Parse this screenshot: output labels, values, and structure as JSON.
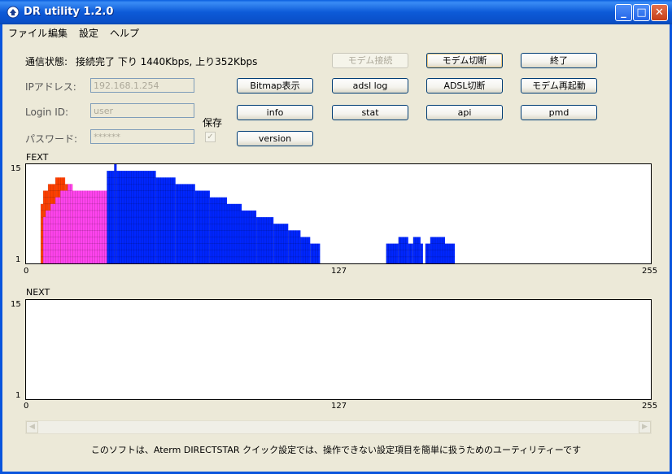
{
  "window": {
    "title": "DR utility 1.2.0"
  },
  "titlebar": {
    "minimize": "_",
    "maximize": "□",
    "close": "✕"
  },
  "menu": [
    "ファイル",
    "編集",
    "設定",
    "ヘルプ"
  ],
  "status": {
    "label": "通信状態:",
    "value": "接続完了 下り 1440Kbps, 上り352Kbps"
  },
  "form": {
    "ip_label": "IPアドレス:",
    "ip_value": "192.168.1.254",
    "login_label": "Login ID:",
    "login_value": "user",
    "password_label": "パスワード:",
    "password_value": "******",
    "save_label": "保存",
    "save_checked": true
  },
  "buttons": {
    "modem_connect": "モデム接続",
    "modem_disconnect": "モデム切断",
    "exit": "終了",
    "bitmap": "Bitmap表示",
    "adsl_log": "adsl log",
    "adsl_disconnect": "ADSL切断",
    "modem_restart": "モデム再起動",
    "info": "info",
    "stat": "stat",
    "api": "api",
    "pmd": "pmd",
    "version": "version"
  },
  "charts": {
    "fext": {
      "label": "FEXT",
      "y_top": "15",
      "y_bottom": "1",
      "x_ticks": [
        "0",
        "127",
        "255"
      ]
    },
    "next": {
      "label": "NEXT",
      "y_top": "15",
      "y_bottom": "1",
      "x_ticks": [
        "0",
        "127",
        "255"
      ]
    }
  },
  "chart_data": [
    {
      "type": "bar",
      "name": "FEXT",
      "xlim": [
        0,
        255
      ],
      "ylim": [
        1,
        15
      ],
      "series": [
        {
          "color": "#ff4000",
          "segments": [
            {
              "x_start": 6,
              "x_end": 7,
              "value": 9
            },
            {
              "x_start": 7,
              "x_end": 9,
              "value": 11
            },
            {
              "x_start": 9,
              "x_end": 12,
              "value": 12
            },
            {
              "x_start": 12,
              "x_end": 16,
              "value": 13
            },
            {
              "x_start": 16,
              "x_end": 19,
              "value": 12
            },
            {
              "x_start": 19,
              "x_end": 30,
              "value": 11
            },
            {
              "x_start": 30,
              "x_end": 33,
              "value": 11
            }
          ]
        },
        {
          "color": "#ff44ee",
          "segments": [
            {
              "x_start": 7,
              "x_end": 8,
              "value": 7
            },
            {
              "x_start": 8,
              "x_end": 10,
              "value": 8
            },
            {
              "x_start": 10,
              "x_end": 12,
              "value": 9
            },
            {
              "x_start": 12,
              "x_end": 14,
              "value": 10
            },
            {
              "x_start": 14,
              "x_end": 17,
              "value": 11
            },
            {
              "x_start": 17,
              "x_end": 19,
              "value": 12
            },
            {
              "x_start": 19,
              "x_end": 33,
              "value": 11
            }
          ]
        },
        {
          "color": "#0026ff",
          "segments": [
            {
              "x_start": 33,
              "x_end": 36,
              "value": 14
            },
            {
              "x_start": 36,
              "x_end": 37,
              "value": 15
            },
            {
              "x_start": 37,
              "x_end": 53,
              "value": 14
            },
            {
              "x_start": 53,
              "x_end": 61,
              "value": 13
            },
            {
              "x_start": 61,
              "x_end": 69,
              "value": 12
            },
            {
              "x_start": 69,
              "x_end": 75,
              "value": 11
            },
            {
              "x_start": 75,
              "x_end": 82,
              "value": 10
            },
            {
              "x_start": 82,
              "x_end": 88,
              "value": 9
            },
            {
              "x_start": 88,
              "x_end": 94,
              "value": 8
            },
            {
              "x_start": 94,
              "x_end": 101,
              "value": 7
            },
            {
              "x_start": 101,
              "x_end": 107,
              "value": 6
            },
            {
              "x_start": 107,
              "x_end": 112,
              "value": 5
            },
            {
              "x_start": 112,
              "x_end": 116,
              "value": 4
            },
            {
              "x_start": 116,
              "x_end": 120,
              "value": 3
            },
            {
              "x_start": 147,
              "x_end": 152,
              "value": 3
            },
            {
              "x_start": 152,
              "x_end": 156,
              "value": 4
            },
            {
              "x_start": 156,
              "x_end": 158,
              "value": 3
            },
            {
              "x_start": 158,
              "x_end": 161,
              "value": 4
            },
            {
              "x_start": 161,
              "x_end": 162,
              "value": 3
            },
            {
              "x_start": 163,
              "x_end": 165,
              "value": 3
            },
            {
              "x_start": 165,
              "x_end": 171,
              "value": 4
            },
            {
              "x_start": 171,
              "x_end": 175,
              "value": 3
            }
          ]
        }
      ]
    },
    {
      "type": "bar",
      "name": "NEXT",
      "xlim": [
        0,
        255
      ],
      "ylim": [
        1,
        15
      ],
      "series": []
    }
  ],
  "footer": "このソフトは、Aterm DIRECTSTAR クイック設定では、操作できない設定項目を簡単に扱うためのユーティリティーです"
}
